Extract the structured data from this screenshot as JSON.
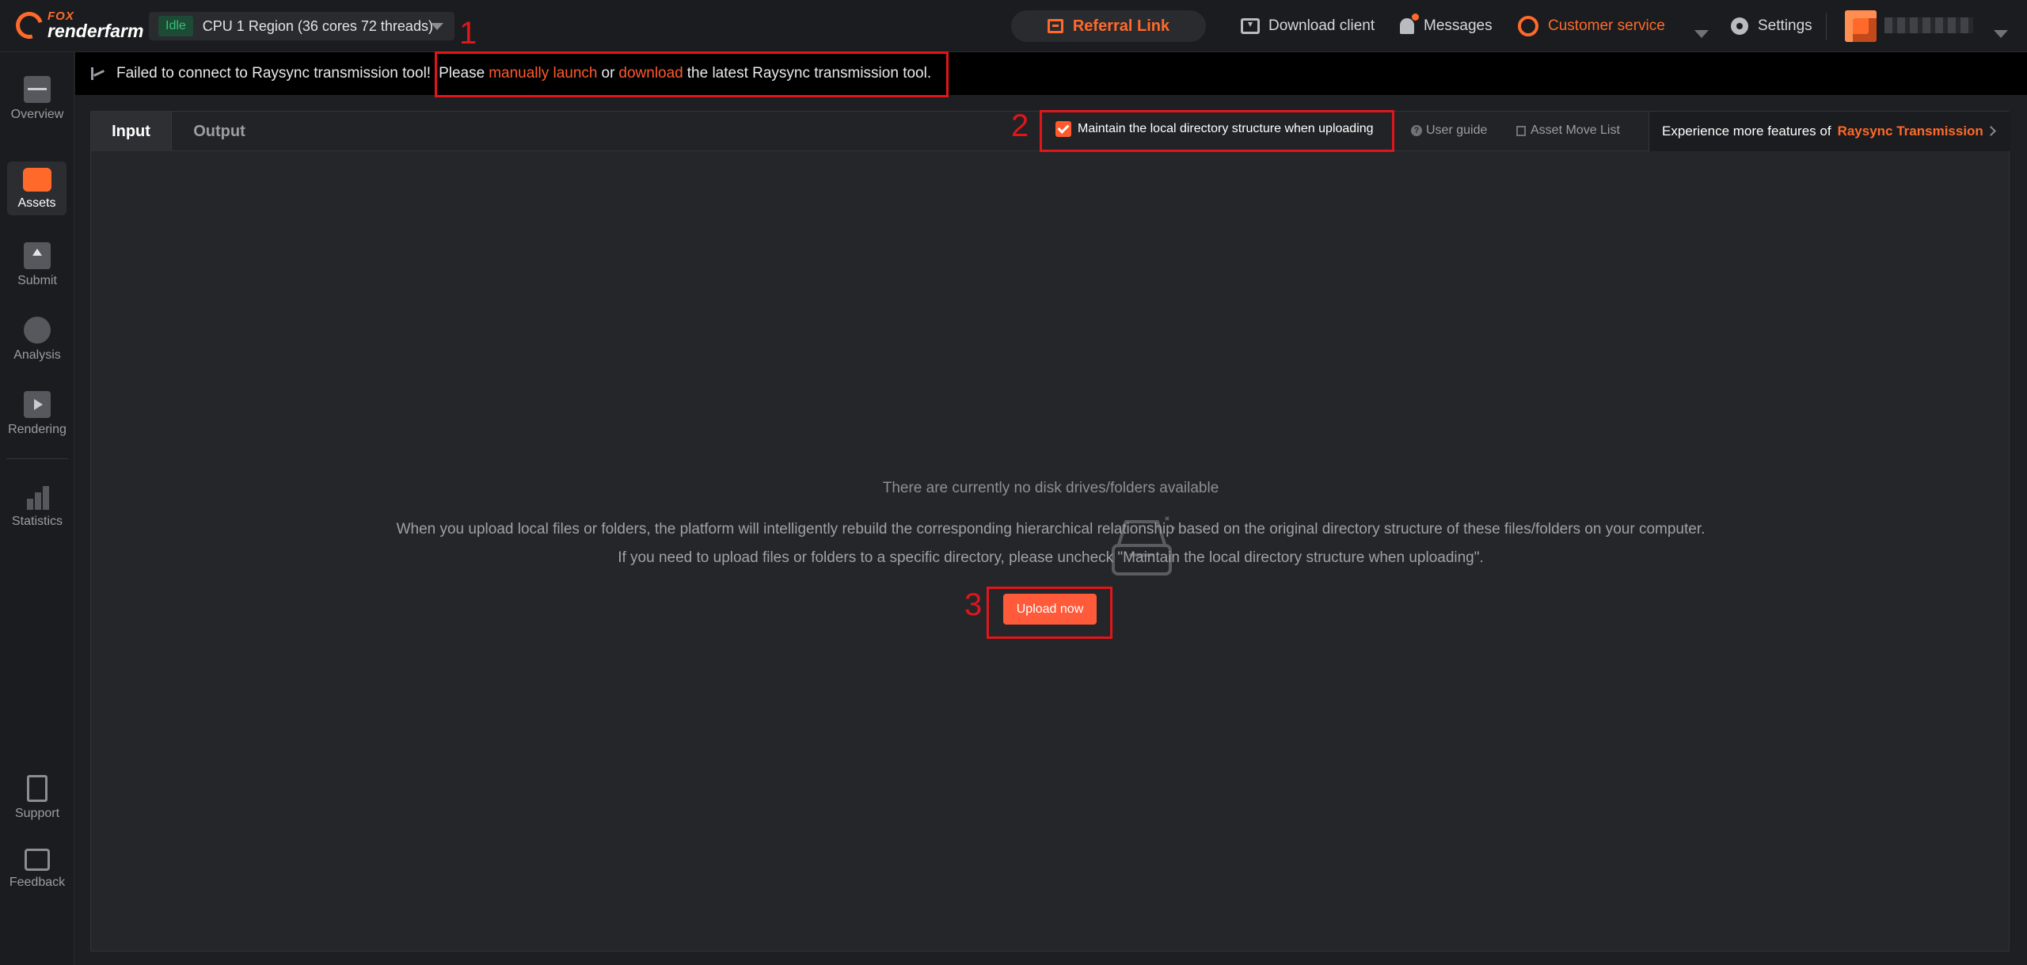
{
  "app": {
    "logo_top": "FOX",
    "logo_bottom": "renderfarm"
  },
  "region": {
    "status": "Idle",
    "label": "CPU 1 Region (36 cores 72 threads)"
  },
  "topbar": {
    "referral": "Referral Link",
    "download_client": "Download client",
    "messages": "Messages",
    "customer_service": "Customer service",
    "settings": "Settings"
  },
  "sidebar": {
    "items": [
      {
        "label": "Overview"
      },
      {
        "label": "Assets"
      },
      {
        "label": "Submit"
      },
      {
        "label": "Analysis"
      },
      {
        "label": "Rendering"
      },
      {
        "label": "Statistics"
      },
      {
        "label": "Support"
      },
      {
        "label": "Feedback"
      }
    ]
  },
  "banner": {
    "prefix": "Failed to connect to Raysync transmission tool!",
    "please": "Please",
    "manual_link": "manually launch",
    "or": "or",
    "download_link": "download",
    "suffix": "the latest Raysync transmission tool."
  },
  "annotations": {
    "a1": "1",
    "a2": "2",
    "a3": "3"
  },
  "tabs": {
    "input": "Input",
    "output": "Output"
  },
  "toolbar": {
    "keep_dir": "Maintain the local directory structure when uploading",
    "keep_dir_checked": true,
    "user_guide": "User guide",
    "asset_move": "Asset Move List",
    "experience_prefix": "Experience more features of",
    "experience_brand": "Raysync Transmission"
  },
  "empty": {
    "title": "There are currently no disk drives/folders available",
    "desc1": "When you upload local files or folders, the platform will intelligently rebuild the corresponding hierarchical relationship based on the original directory structure of these files/folders on your computer.",
    "desc2": "If you need to upload files or folders to a specific directory, please uncheck \"Maintain the local directory structure when uploading\".",
    "upload_button": "Upload now"
  },
  "colors": {
    "accent": "#ff6a2b",
    "annotation": "#e0161b",
    "idle": "#33c17a"
  }
}
